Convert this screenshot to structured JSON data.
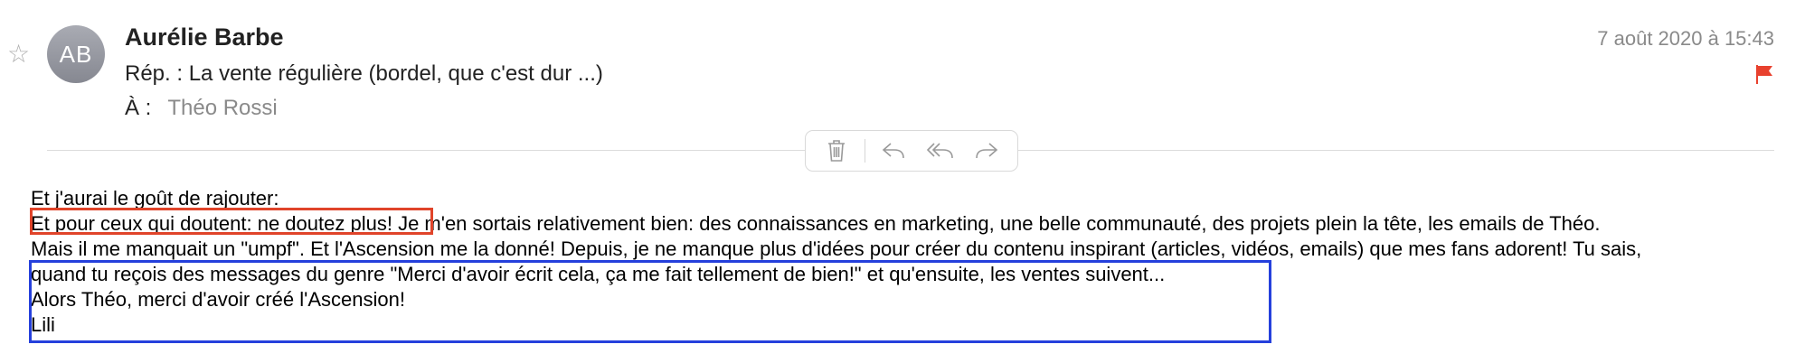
{
  "message": {
    "sender_initials": "AB",
    "sender_name": "Aurélie Barbe",
    "subject": "Rép. : La vente régulière (bordel, que c'est dur ...)",
    "to_label": "À :",
    "to_name": "Théo Rossi",
    "date": "7 août 2020 à 15:43",
    "flag_color": "#e8412e"
  },
  "toolbar": {
    "icons": [
      "trash-icon",
      "reply-icon",
      "reply-all-icon",
      "forward-icon"
    ]
  },
  "body": {
    "line1": "Et j'aurai le goût de rajouter:",
    "line2_highlight": "Et pour ceux qui doutent: ne doutez plus!",
    "line2_rest": " Je m'en sortais relativement bien: des connaissances en marketing, une belle communauté, des projets plein la tête, les emails de Théo.",
    "line3": "Mais il me manquait un \"umpf\". Et l'Ascension me la donné! Depuis, je ne manque plus d'idées pour créer du contenu inspirant (articles, vidéos, emails) que mes fans adorent! Tu sais,",
    "line4": "quand tu reçois des messages du genre \"Merci d'avoir écrit cela, ça me fait tellement de bien!\" et qu'ensuite, les ventes suivent...",
    "line5": "Alors Théo, merci d'avoir créé l'Ascension!",
    "line6": "Lili"
  },
  "annotations": {
    "red_box_color": "#e0442a",
    "blue_box_color": "#2540dc"
  }
}
